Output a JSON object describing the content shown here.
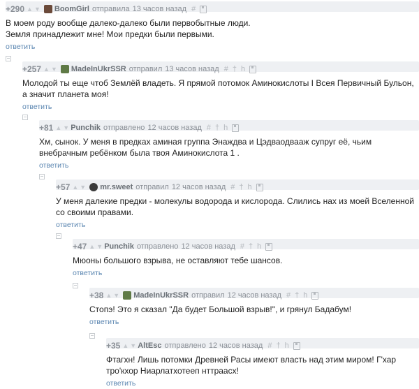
{
  "comments": [
    {
      "rating": "+290",
      "author": "BoomGirl",
      "action": "отправила",
      "time": "13 часов назад",
      "text": "В моем роду вообще далеко-далеко были первобытные люди.\nЗемля принадлежит мне! Мои предки были первыми.",
      "reply": "ответить"
    },
    {
      "rating": "+257",
      "author": "MadeInUkrSSR",
      "action": "отправил",
      "time": "13 часов назад",
      "text": "Молодой ты еще чтоб Землёй владеть. Я прямой потомок Аминокислоты I Всея Первичный Бульон, а значит планета моя!",
      "reply": "ответить"
    },
    {
      "rating": "+81",
      "author": "Punchik",
      "action": "отправлено",
      "time": "12 часов назад",
      "text": "Хм, сынок. У  меня в предках аминая группа Энаждва и Цэдваодвааж супруг её, чьим внебрачным ребёнком была твоя Аминокислота 1 .",
      "reply": "ответить"
    },
    {
      "rating": "+57",
      "author": "mr.sweet",
      "action": "отправил",
      "time": "12 часов назад",
      "text": "У меня далекие предки - молекулы водорода и кислорода. Слились нах из моей Вселенной со своими правами.",
      "reply": "ответить"
    },
    {
      "rating": "+47",
      "author": "Punchik",
      "action": "отправлено",
      "time": "12 часов назад",
      "text": "Мюоны большого взрыва, не оставляют тебе шансов.",
      "reply": "ответить"
    },
    {
      "rating": "+38",
      "author": "MadeInUkrSSR",
      "action": "отправил",
      "time": "12 часов назад",
      "text": "Стопэ! Это я сказал \"Да будет Большой взрыв!\", и грянул Бадабум!",
      "reply": "ответить"
    },
    {
      "rating": "+35",
      "author": "AltEsc",
      "action": "отправлено",
      "time": "12 часов назад",
      "text": "Фтагхн! Лишь потомки Древней Расы имеют власть над этим миром! Г'хар тро'кхор Ниарлатхотееп нттраасх!",
      "reply": "ответить"
    }
  ],
  "ui": {
    "vote_up": "▲",
    "vote_down": "▼",
    "tool_hash": "#",
    "tool_dagger": "†",
    "tool_h": "h"
  }
}
